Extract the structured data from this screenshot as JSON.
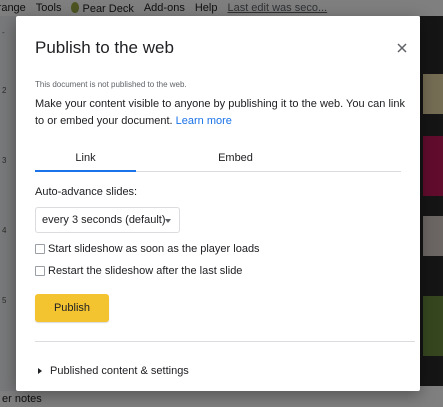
{
  "background": {
    "menu": [
      "rrange",
      "Tools",
      "Pear Deck",
      "Add-ons",
      "Help"
    ],
    "last_edit": "Last edit was seco...",
    "left_markers": [
      "-",
      "2",
      "3",
      "4",
      "5"
    ],
    "bottom_text": "er notes"
  },
  "dialog": {
    "title": "Publish to the web",
    "status": "This document is not published to the web.",
    "intro": "Make your content visible to anyone by publishing it to the web. You can link to or embed your document.",
    "learn_more": "Learn more",
    "tabs": [
      "Link",
      "Embed"
    ],
    "active_tab": "Link",
    "auto_advance_label": "Auto-advance slides:",
    "auto_advance_value": "every 3 seconds (default)",
    "checkbox_start": "Start slideshow as soon as the player loads",
    "checkbox_restart": "Restart the slideshow after the last slide",
    "publish_label": "Publish",
    "published_settings": "Published content & settings"
  },
  "colors": {
    "accent": "#1a73e8",
    "publish": "#f4c430"
  }
}
